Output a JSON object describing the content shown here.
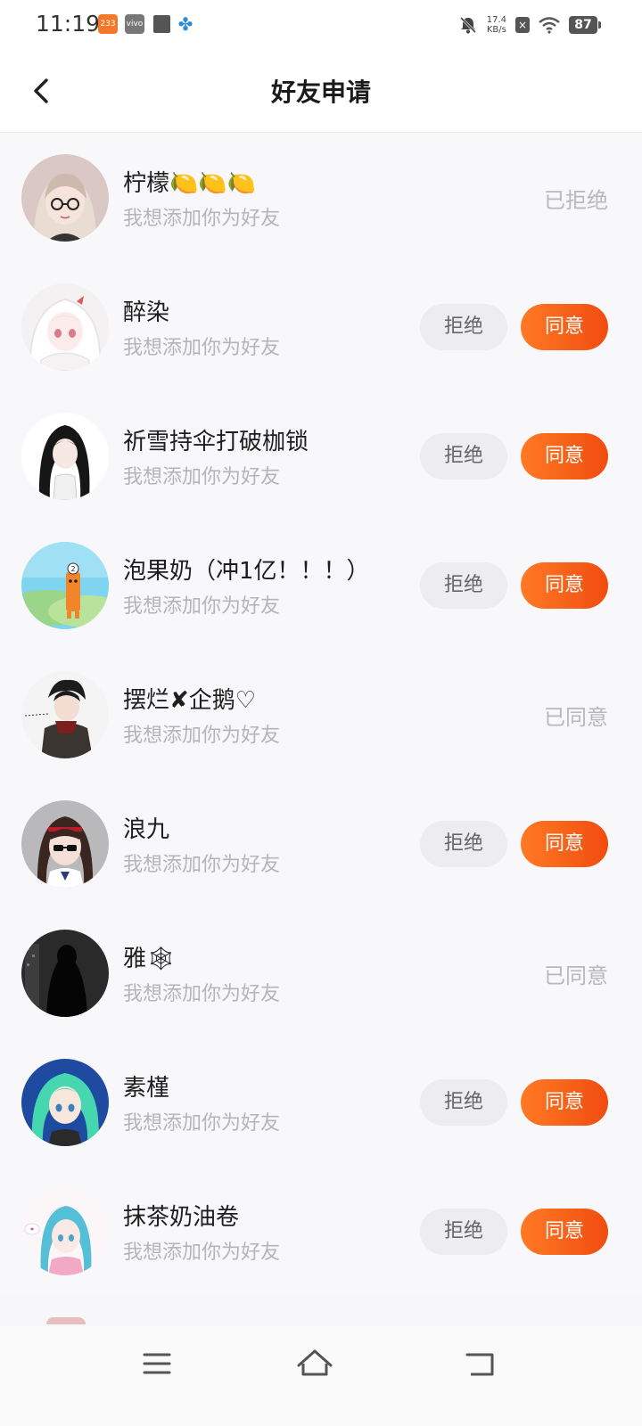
{
  "status_bar": {
    "time": "11:19",
    "notif_icons": [
      "233-app-icon",
      "vivo-icon",
      "square-icon",
      "fan-icon"
    ],
    "app_badge_233": "233",
    "app_badge_vivo": "vivo",
    "net_speed_value": "17.4",
    "net_speed_unit": "KB/s",
    "battery": "87"
  },
  "header": {
    "title": "好友申请"
  },
  "colors": {
    "accent": "#f45a15",
    "reject_bg": "#ececf1",
    "muted_text": "#b5b5b8"
  },
  "requests": [
    {
      "name": "柠檬🍋🍋🍋",
      "message": "我想添加你为好友",
      "status": "已拒绝",
      "reject_label": "",
      "accept_label": ""
    },
    {
      "name": "醉染",
      "message": "我想添加你为好友",
      "status": "",
      "reject_label": "拒绝",
      "accept_label": "同意"
    },
    {
      "name": "祈雪持伞打破枷锁",
      "message": "我想添加你为好友",
      "status": "",
      "reject_label": "拒绝",
      "accept_label": "同意"
    },
    {
      "name": "泡果奶（冲1亿！！！）",
      "message": "我想添加你为好友",
      "status": "",
      "reject_label": "拒绝",
      "accept_label": "同意"
    },
    {
      "name": "摆烂✘企鹅♡",
      "message": "我想添加你为好友",
      "status": "已同意",
      "reject_label": "",
      "accept_label": ""
    },
    {
      "name": "浪九",
      "message": "我想添加你为好友",
      "status": "",
      "reject_label": "拒绝",
      "accept_label": "同意"
    },
    {
      "name": "雅🕸",
      "message": "我想添加你为好友",
      "status": "已同意",
      "reject_label": "",
      "accept_label": ""
    },
    {
      "name": "素槿",
      "message": "我想添加你为好友",
      "status": "",
      "reject_label": "拒绝",
      "accept_label": "同意"
    },
    {
      "name": "抹茶奶油卷",
      "message": "我想添加你为好友",
      "status": "",
      "reject_label": "拒绝",
      "accept_label": "同意"
    }
  ],
  "nav_bar": {
    "icons": [
      "menu-icon",
      "home-icon",
      "back-icon"
    ]
  }
}
